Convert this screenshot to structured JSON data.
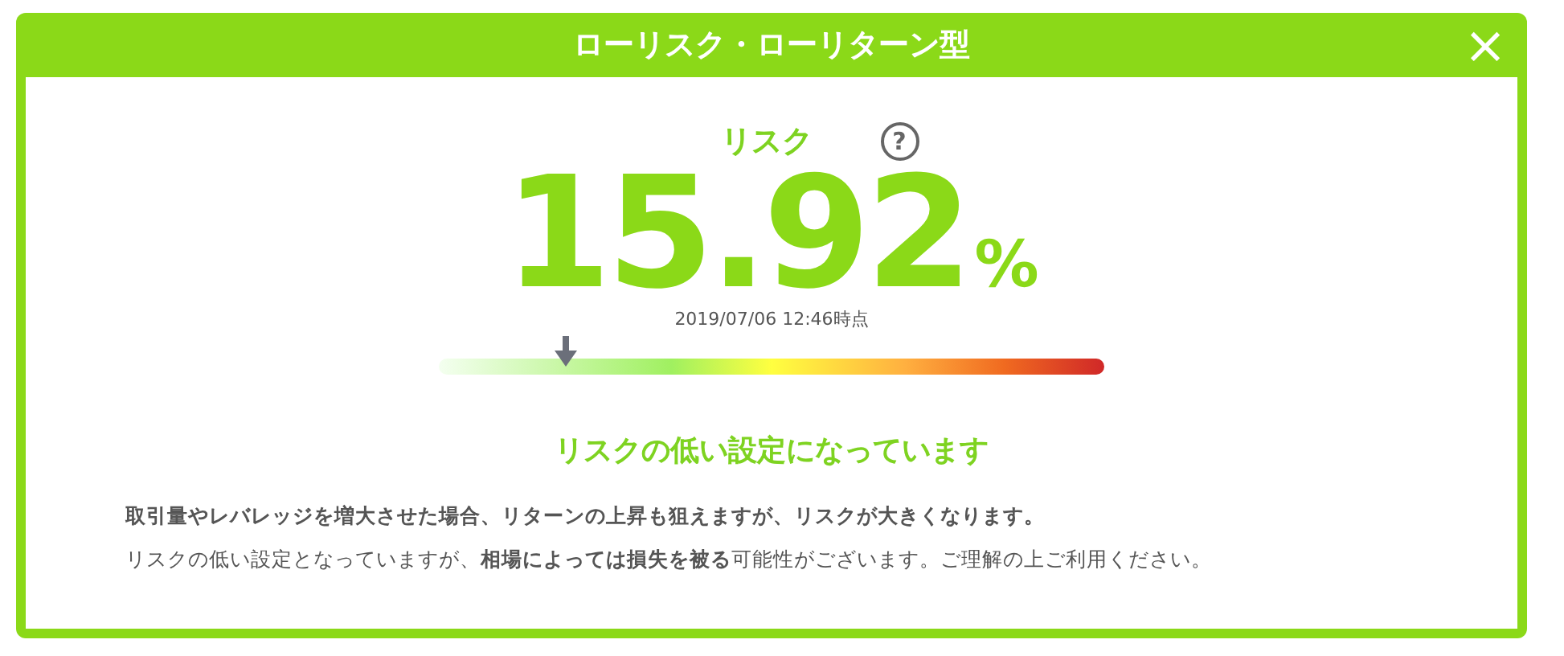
{
  "dialog": {
    "title": "ローリスク・ローリターン型",
    "close_label": "×"
  },
  "risk": {
    "label": "リスク",
    "help_label": "?",
    "value": "15.92",
    "unit": "%",
    "timestamp": "2019/07/06 12:46時点",
    "gauge": {
      "level": 0.19
    }
  },
  "message": {
    "heading": "リスクの低い設定になっています",
    "lines": [
      "**取引量やレバレッジを増大させた場合、リターンの上昇も狙えますが、リスクが大きくなります。**",
      "リスクの低い設定となっていますが、**相場によっては損失を被る**可能性がございます。ご理解の上ご利用ください。"
    ]
  }
}
